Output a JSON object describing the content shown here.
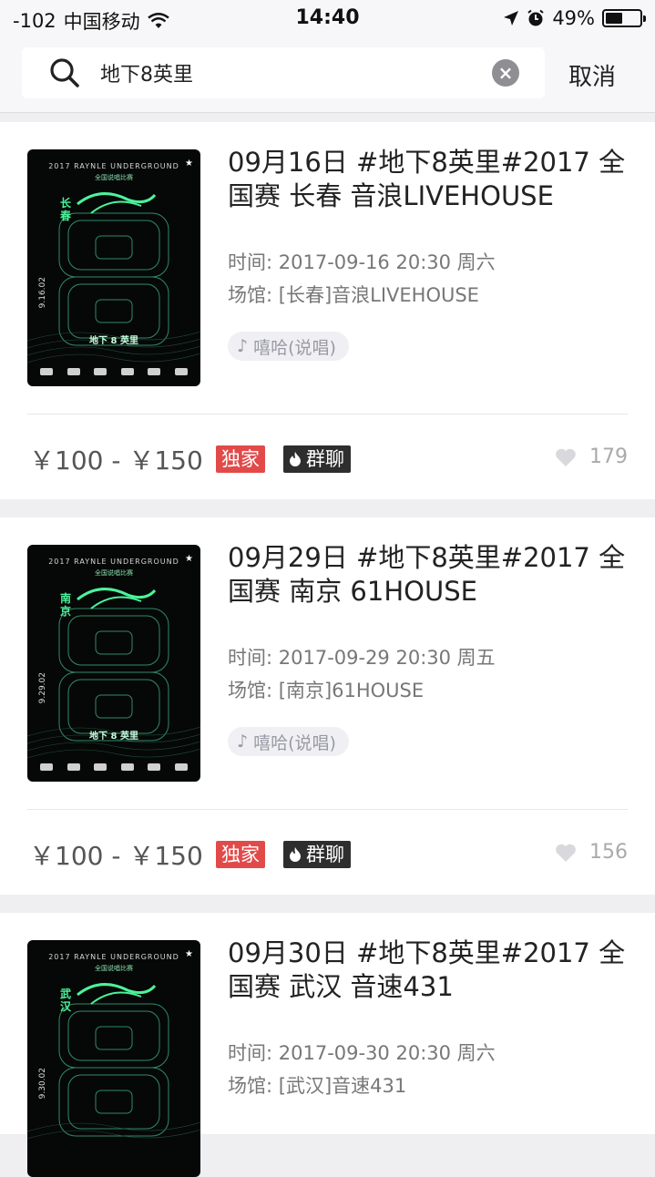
{
  "status_bar": {
    "signal": "-102",
    "carrier": "中国移动",
    "time": "14:40",
    "battery": "49%",
    "icons": [
      "wifi-icon",
      "location-arrow-icon",
      "alarm-icon",
      "battery-icon"
    ]
  },
  "search": {
    "query": "地下8英里",
    "placeholder": "",
    "cancel_label": "取消"
  },
  "events": [
    {
      "title": "09月16日 #地下8英里#2017 全国赛 长春 音浪LIVEHOUSE",
      "time": "时间: 2017-09-16 20:30 周六",
      "venue": "场馆: [长春]音浪LIVEHOUSE",
      "genre": "嘻哈(说唱)",
      "price": "￥100 - ￥150",
      "badge_exclusive": "独家",
      "badge_group": "群聊",
      "likes": "179"
    },
    {
      "title": "09月29日 #地下8英里#2017 全国赛 南京 61HOUSE",
      "time": "时间: 2017-09-29 20:30 周五",
      "venue": "场馆: [南京]61HOUSE",
      "genre": "嘻哈(说唱)",
      "price": "￥100 - ￥150",
      "badge_exclusive": "独家",
      "badge_group": "群聊",
      "likes": "156"
    },
    {
      "title": "09月30日 #地下8英里#2017 全国赛 武汉 音速431",
      "time": "时间: 2017-09-30 20:30 周六",
      "venue": "场馆: [武汉]音速431"
    }
  ],
  "colors": {
    "exclusive_badge": "#e24a4a",
    "group_badge": "#2e2e2e",
    "page_bg": "#efeff2",
    "poster_accent": "#4cf39a"
  }
}
